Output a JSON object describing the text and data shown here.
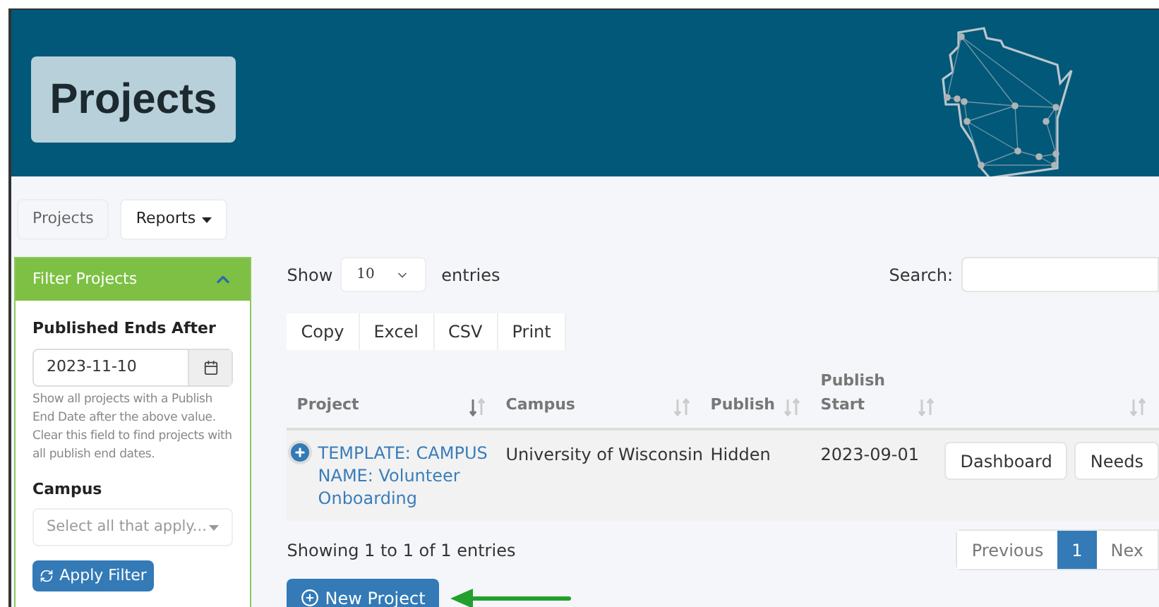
{
  "header": {
    "title": "Projects"
  },
  "nav": [
    {
      "label": "Projects",
      "selected": true,
      "dropdown": false
    },
    {
      "label": "Reports",
      "selected": false,
      "dropdown": true
    }
  ],
  "filter": {
    "title": "Filter Projects",
    "expanded": true,
    "date_label": "Published Ends After",
    "date_value": "2023-11-10",
    "help": "Show all projects with a Publish End Date after the above value. Clear this field to find projects with all publish end dates.",
    "campus_label": "Campus",
    "campus_placeholder": "Select all that apply...",
    "apply_button": "Apply Filter"
  },
  "length": {
    "prefix": "Show",
    "value": "10",
    "suffix": "entries"
  },
  "search": {
    "label": "Search:"
  },
  "export_buttons": [
    "Copy",
    "Excel",
    "CSV",
    "Print"
  ],
  "table": {
    "columns": [
      {
        "label": "Project",
        "sorted": true
      },
      {
        "label": "Campus",
        "sorted": false
      },
      {
        "label": "Publish",
        "sorted": false
      },
      {
        "label": "Publish Start",
        "sorted": false
      },
      {
        "sorted": false
      }
    ],
    "rows": [
      {
        "project": "TEMPLATE: CAMPUS NAME: Volunteer Onboarding",
        "campus": "University of Wisconsin",
        "publish": "Hidden",
        "publish_start": "2023-09-01",
        "actions": [
          "Dashboard",
          "Needs"
        ]
      }
    ]
  },
  "info": "Showing 1 to 1 of 1 entries",
  "pagination": [
    {
      "label": "Previous",
      "selected": false
    },
    {
      "label": "1",
      "selected": true
    },
    {
      "label": "Nex",
      "selected": false
    }
  ],
  "new_button": "New Project"
}
